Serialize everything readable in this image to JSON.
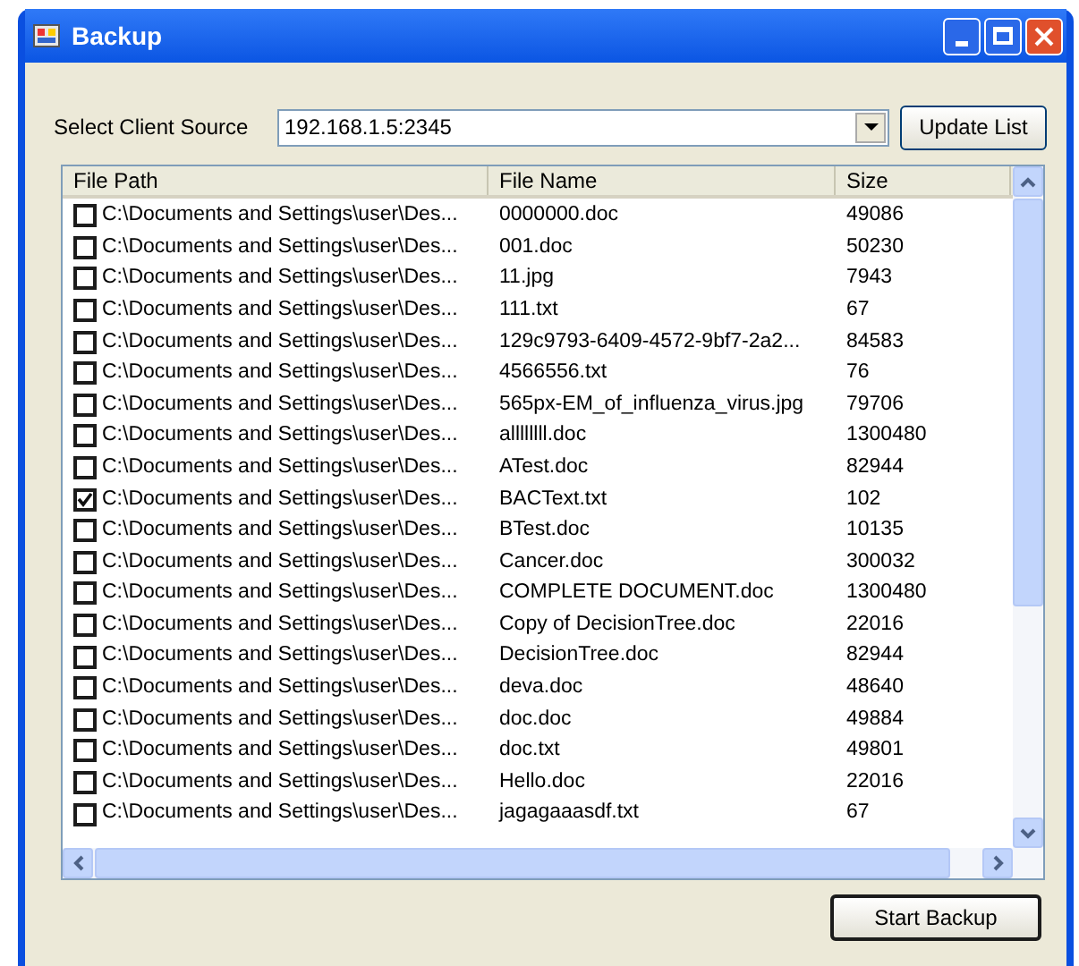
{
  "window": {
    "title": "Backup"
  },
  "source": {
    "label": "Select Client Source",
    "value": "192.168.1.5:2345"
  },
  "update_button": "Update List",
  "table": {
    "columns": [
      "File Path",
      "File Name",
      "Size"
    ],
    "rows": [
      {
        "path": "C:\\Documents and Settings\\user\\Des...",
        "name": "0000000.doc",
        "size": "49086",
        "checked": false
      },
      {
        "path": "C:\\Documents and Settings\\user\\Des...",
        "name": "001.doc",
        "size": "50230",
        "checked": false
      },
      {
        "path": "C:\\Documents and Settings\\user\\Des...",
        "name": "11.jpg",
        "size": "7943",
        "checked": false
      },
      {
        "path": "C:\\Documents and Settings\\user\\Des...",
        "name": "111.txt",
        "size": "67",
        "checked": false
      },
      {
        "path": "C:\\Documents and Settings\\user\\Des...",
        "name": "129c9793-6409-4572-9bf7-2a2...",
        "size": "84583",
        "checked": false
      },
      {
        "path": "C:\\Documents and Settings\\user\\Des...",
        "name": "4566556.txt",
        "size": "76",
        "checked": false
      },
      {
        "path": "C:\\Documents and Settings\\user\\Des...",
        "name": "565px-EM_of_influenza_virus.jpg",
        "size": "79706",
        "checked": false
      },
      {
        "path": "C:\\Documents and Settings\\user\\Des...",
        "name": "allllllll.doc",
        "size": "1300480",
        "checked": false
      },
      {
        "path": "C:\\Documents and Settings\\user\\Des...",
        "name": "ATest.doc",
        "size": "82944",
        "checked": false
      },
      {
        "path": "C:\\Documents and Settings\\user\\Des...",
        "name": "BACText.txt",
        "size": "102",
        "checked": true
      },
      {
        "path": "C:\\Documents and Settings\\user\\Des...",
        "name": "BTest.doc",
        "size": "10135",
        "checked": false
      },
      {
        "path": "C:\\Documents and Settings\\user\\Des...",
        "name": "Cancer.doc",
        "size": "300032",
        "checked": false
      },
      {
        "path": "C:\\Documents and Settings\\user\\Des...",
        "name": "COMPLETE DOCUMENT.doc",
        "size": "1300480",
        "checked": false
      },
      {
        "path": "C:\\Documents and Settings\\user\\Des...",
        "name": "Copy of DecisionTree.doc",
        "size": "22016",
        "checked": false
      },
      {
        "path": "C:\\Documents and Settings\\user\\Des...",
        "name": "DecisionTree.doc",
        "size": "82944",
        "checked": false
      },
      {
        "path": "C:\\Documents and Settings\\user\\Des...",
        "name": "deva.doc",
        "size": "48640",
        "checked": false
      },
      {
        "path": "C:\\Documents and Settings\\user\\Des...",
        "name": "doc.doc",
        "size": "49884",
        "checked": false
      },
      {
        "path": "C:\\Documents and Settings\\user\\Des...",
        "name": "doc.txt",
        "size": "49801",
        "checked": false
      },
      {
        "path": "C:\\Documents and Settings\\user\\Des...",
        "name": "Hello.doc",
        "size": "22016",
        "checked": false
      },
      {
        "path": "C:\\Documents and Settings\\user\\Des...",
        "name": "jagagaaasdf.txt",
        "size": "67",
        "checked": false
      }
    ]
  },
  "start_button": "Start Backup"
}
